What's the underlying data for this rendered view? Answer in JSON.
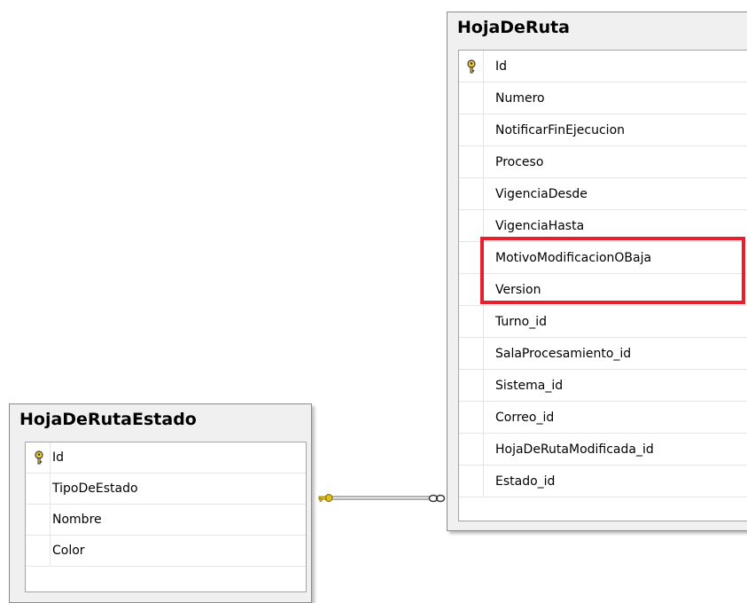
{
  "tables": {
    "estado": {
      "title": "HojaDeRutaEstado",
      "columns": [
        {
          "name": "Id",
          "primary_key": true
        },
        {
          "name": "TipoDeEstado",
          "primary_key": false
        },
        {
          "name": "Nombre",
          "primary_key": false
        },
        {
          "name": "Color",
          "primary_key": false
        }
      ]
    },
    "hoja": {
      "title": "HojaDeRuta",
      "columns": [
        {
          "name": "Id",
          "primary_key": true
        },
        {
          "name": "Numero",
          "primary_key": false
        },
        {
          "name": "NotificarFinEjecucion",
          "primary_key": false
        },
        {
          "name": "Proceso",
          "primary_key": false
        },
        {
          "name": "VigenciaDesde",
          "primary_key": false
        },
        {
          "name": "VigenciaHasta",
          "primary_key": false
        },
        {
          "name": "MotivoModificacionOBaja",
          "primary_key": false
        },
        {
          "name": "Version",
          "primary_key": false
        },
        {
          "name": "Turno_id",
          "primary_key": false
        },
        {
          "name": "SalaProcesamiento_id",
          "primary_key": false
        },
        {
          "name": "Sistema_id",
          "primary_key": false
        },
        {
          "name": "Correo_id",
          "primary_key": false
        },
        {
          "name": "HojaDeRutaModificada_id",
          "primary_key": false
        },
        {
          "name": "Estado_id",
          "primary_key": false
        }
      ]
    }
  },
  "relationship": {
    "one_end": "HojaDeRutaEstado",
    "many_end": "HojaDeRuta",
    "one_end_icon": "key-icon",
    "many_end_icon": "infinity-icon"
  },
  "highlight": {
    "color": "#e8202d",
    "columns": [
      "MotivoModificacionOBaja",
      "Version"
    ]
  }
}
